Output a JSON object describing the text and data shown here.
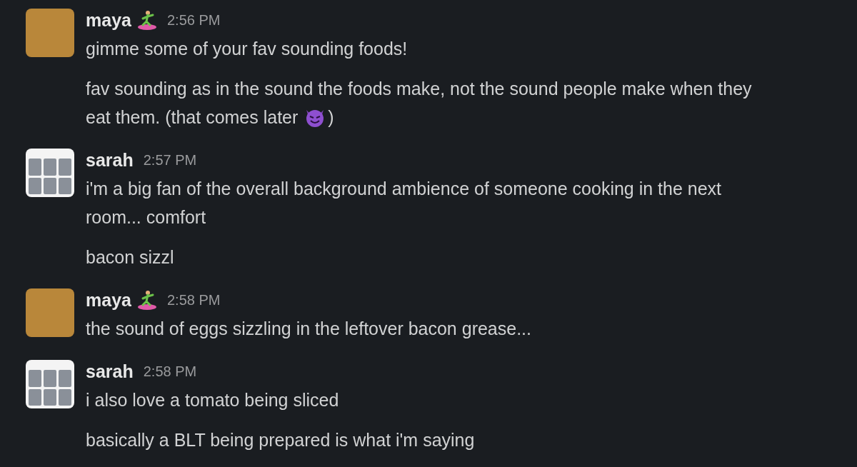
{
  "messages": [
    {
      "author": "maya",
      "avatar": {
        "kind": "cartoon"
      },
      "has_status_emoji": true,
      "time": "2:56 PM",
      "paragraphs": [
        [
          [
            {
              "kind": "text",
              "text": "gimme some of your fav sounding foods!"
            }
          ]
        ],
        [
          [
            {
              "kind": "text",
              "text": "fav sounding as in the sound the foods make, not the sound people make when they"
            }
          ],
          [
            {
              "kind": "text",
              "text": "eat them. (that comes later"
            },
            {
              "kind": "emoji"
            },
            {
              "kind": "text",
              "text": ")"
            }
          ]
        ]
      ]
    },
    {
      "author": "sarah",
      "avatar": {
        "kind": "grid"
      },
      "has_status_emoji": false,
      "time": "2:57 PM",
      "paragraphs": [
        [
          [
            {
              "kind": "text",
              "text": "i'm a big fan of the overall background ambience of someone cooking in the next"
            }
          ],
          [
            {
              "kind": "text",
              "text": "room... comfort"
            }
          ]
        ],
        [
          [
            {
              "kind": "text",
              "text": "bacon sizzl"
            }
          ]
        ]
      ]
    },
    {
      "author": "maya",
      "avatar": {
        "kind": "cartoon"
      },
      "has_status_emoji": true,
      "time": "2:58 PM",
      "paragraphs": [
        [
          [
            {
              "kind": "text",
              "text": "the sound of eggs sizzling in the leftover bacon grease..."
            }
          ]
        ]
      ]
    },
    {
      "author": "sarah",
      "avatar": {
        "kind": "grid"
      },
      "has_status_emoji": false,
      "time": "2:58 PM",
      "paragraphs": [
        [
          [
            {
              "kind": "text",
              "text": "i also love a tomato being sliced"
            }
          ]
        ],
        [
          [
            {
              "kind": "text",
              "text": "basically a BLT being prepared is what i'm saying"
            }
          ]
        ]
      ]
    }
  ]
}
